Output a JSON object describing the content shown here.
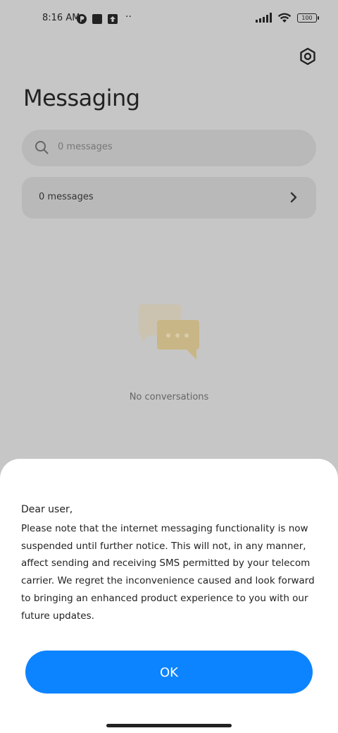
{
  "status_bar": {
    "time": "8:16 AM",
    "more": "··",
    "battery": "100"
  },
  "header": {
    "title": "Messaging",
    "settings_icon": "hexagon-gear-icon"
  },
  "search": {
    "placeholder": "0 messages",
    "icon": "search-icon"
  },
  "messages_row": {
    "label": "0 messages",
    "icon": "chevron-right-icon"
  },
  "empty_state": {
    "icon": "chat-bubbles-icon",
    "text": "No conversations"
  },
  "dialog": {
    "greeting": "Dear user,",
    "body": "Please note that the internet messaging functionality is now suspended until further notice. This will not, in any manner, affect sending and receiving SMS permitted by your telecom carrier. We regret the inconvenience caused and look forward to bringing an enhanced product experience to you with our future updates.",
    "ok_label": "OK",
    "ok_color": "#0d84ff"
  }
}
